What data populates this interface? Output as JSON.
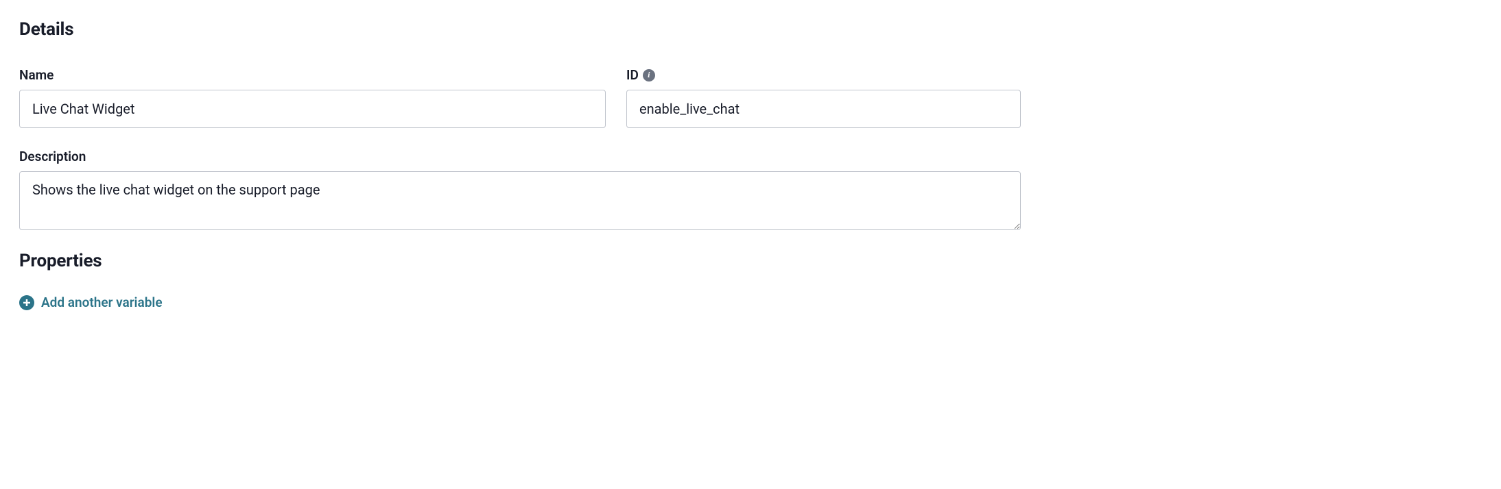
{
  "details": {
    "heading": "Details",
    "name": {
      "label": "Name",
      "value": "Live Chat Widget"
    },
    "id": {
      "label": "ID",
      "value": "enable_live_chat"
    },
    "description": {
      "label": "Description",
      "value": "Shows the live chat widget on the support page"
    }
  },
  "properties": {
    "heading": "Properties",
    "add_link": "Add another variable"
  }
}
